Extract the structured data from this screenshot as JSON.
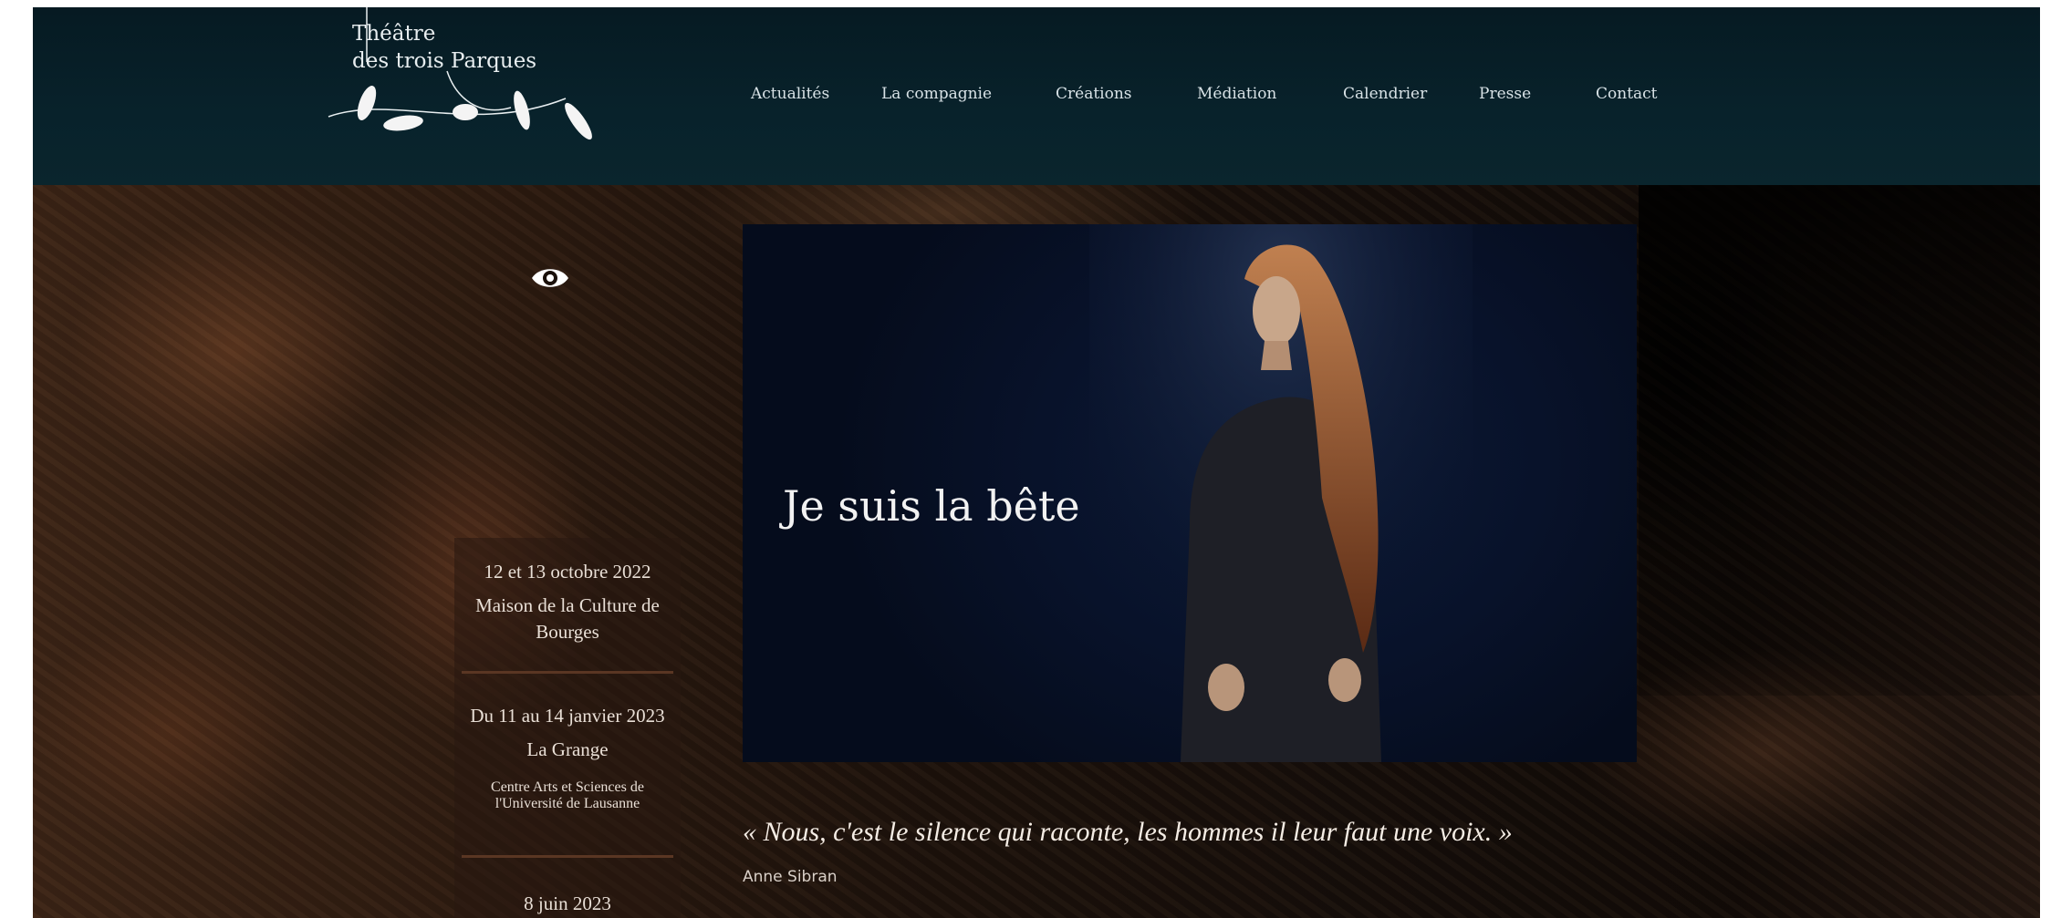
{
  "brand": {
    "line1": "Théâtre",
    "line2": "des trois Parques"
  },
  "nav": {
    "items": [
      {
        "label": "Actualités"
      },
      {
        "label": "La compagnie"
      },
      {
        "label": "Créations"
      },
      {
        "label": "Médiation"
      },
      {
        "label": "Calendrier"
      },
      {
        "label": "Presse"
      },
      {
        "label": "Contact"
      }
    ]
  },
  "icons": {
    "view": "eye-icon",
    "logo": "parques-figures-logo"
  },
  "dates": [
    {
      "date": "12 et 13 octobre 2022",
      "venue_line1": "Maison de la Culture de",
      "venue_line2": "Bourges"
    },
    {
      "date": "Du 11 au 14 janvier 2023",
      "venue_line1": "La Grange",
      "sub_line1": "Centre Arts et Sciences de",
      "sub_line2": "l'Université de Lausanne"
    },
    {
      "date": "8 juin 2023"
    }
  ],
  "feature": {
    "title": "Je suis la bête",
    "quote": "« Nous, c'est le silence qui raconte, les hommes il leur faut une voix. »",
    "author": "Anne Sibran"
  },
  "colors": {
    "header_bg": "#08222b",
    "card_bg": "#08122a",
    "text_light": "#e9dfd6"
  }
}
